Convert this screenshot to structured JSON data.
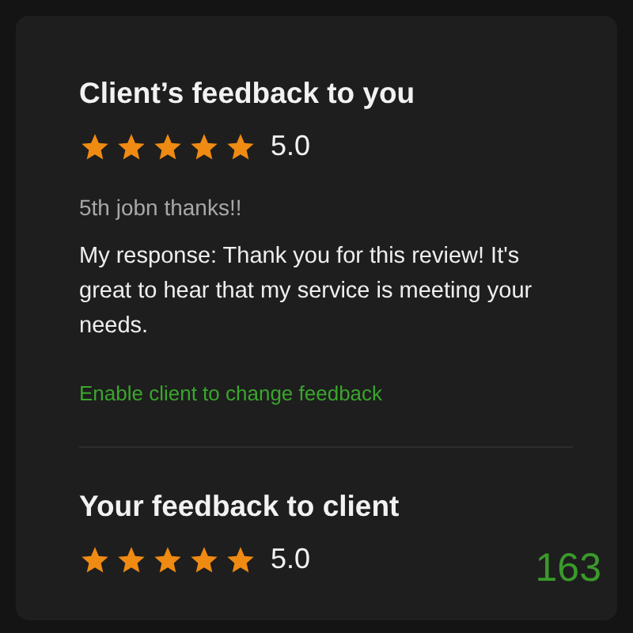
{
  "client_feedback": {
    "title": "Client’s feedback to you",
    "stars": 5,
    "rating": "5.0",
    "comment": "5th jobn thanks!!",
    "response": "My response: Thank you for this review! It's great to hear that my service is meeting your needs.",
    "link": "Enable client to change feedback"
  },
  "your_feedback": {
    "title": "Your feedback to client",
    "stars": 5,
    "rating": "5.0"
  },
  "counter": "163"
}
